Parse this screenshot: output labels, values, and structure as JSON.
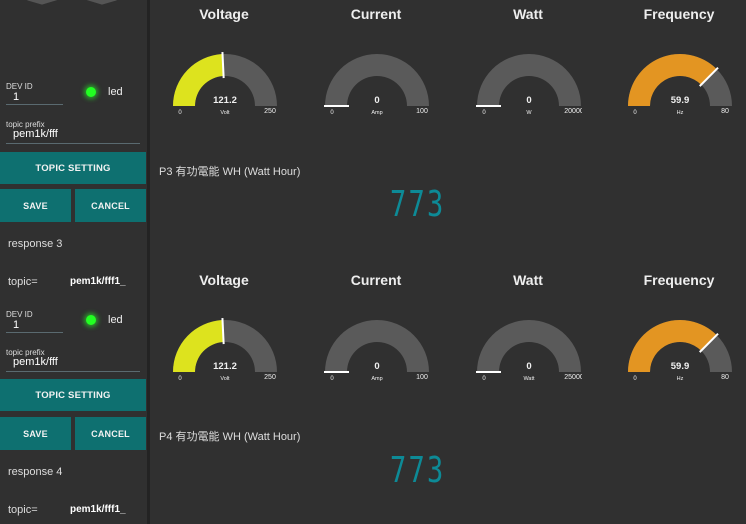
{
  "panels": [
    {
      "devid_label": "DEV ID",
      "devid_value": "1",
      "led_label": "led",
      "prefix_label": "topic prefix",
      "prefix_value": "pem1k/fff",
      "topic_setting_label": "TOPIC SETTING",
      "save_label": "SAVE",
      "cancel_label": "CANCEL",
      "response": "response 3",
      "topic_key": "topic=",
      "topic_value": "pem1k/fff1_"
    },
    {
      "devid_label": "DEV ID",
      "devid_value": "1",
      "led_label": "led",
      "prefix_label": "topic prefix",
      "prefix_value": "pem1k/fff",
      "topic_setting_label": "TOPIC SETTING",
      "save_label": "SAVE",
      "cancel_label": "CANCEL",
      "response": "response 4",
      "topic_key": "topic=",
      "topic_value": "pem1k/fff1_"
    }
  ],
  "sections": [
    {
      "gauges": [
        {
          "title": "Voltage",
          "value": "121.2",
          "val": 121.2,
          "min": "0",
          "max": "250",
          "minv": 0,
          "maxv": 250,
          "unit": "Volt",
          "color": "#dde31e"
        },
        {
          "title": "Current",
          "value": "0",
          "val": 0,
          "min": "0",
          "max": "100",
          "minv": 0,
          "maxv": 100,
          "unit": "Amp",
          "color": "#dde31e"
        },
        {
          "title": "Watt",
          "value": "0",
          "val": 0,
          "min": "0",
          "max": "20000",
          "minv": 0,
          "maxv": 20000,
          "unit": "W",
          "color": "#dde31e"
        },
        {
          "title": "Frequency",
          "value": "59.9",
          "val": 59.9,
          "min": "0",
          "max": "80",
          "minv": 0,
          "maxv": 80,
          "unit": "Hz",
          "color": "#e39522"
        }
      ],
      "wh_label": "P3 有功電能 WH (Watt Hour)",
      "wh_value": "773"
    },
    {
      "gauges": [
        {
          "title": "Voltage",
          "value": "121.2",
          "val": 121.2,
          "min": "0",
          "max": "250",
          "minv": 0,
          "maxv": 250,
          "unit": "Volt",
          "color": "#dde31e"
        },
        {
          "title": "Current",
          "value": "0",
          "val": 0,
          "min": "0",
          "max": "100",
          "minv": 0,
          "maxv": 100,
          "unit": "Amp",
          "color": "#dde31e"
        },
        {
          "title": "Watt",
          "value": "0",
          "val": 0,
          "min": "0",
          "max": "25000",
          "minv": 0,
          "maxv": 25000,
          "unit": "Watt",
          "color": "#dde31e"
        },
        {
          "title": "Frequency",
          "value": "59.9",
          "val": 59.9,
          "min": "0",
          "max": "80",
          "minv": 0,
          "maxv": 80,
          "unit": "Hz",
          "color": "#e39522"
        }
      ],
      "wh_label": "P4 有功電能 WH (Watt Hour)",
      "wh_value": "773"
    }
  ],
  "colors": {
    "teal_button": "#0e7070",
    "led_on": "#22ff22",
    "gauge_track": "#5a5a5a",
    "lcd_digits": "#0d8a96"
  }
}
